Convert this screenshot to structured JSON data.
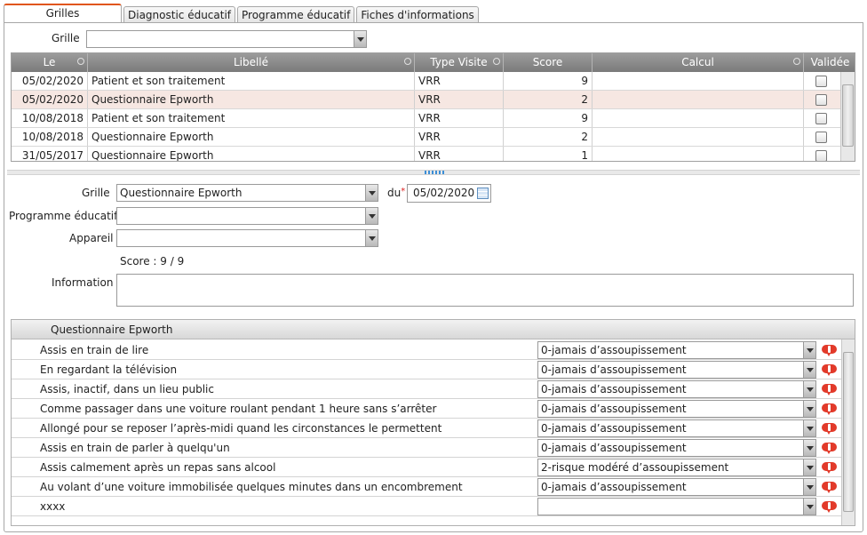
{
  "tabs": [
    "Grilles",
    "Diagnostic éducatif",
    "Programme éducatif",
    "Fiches d'informations"
  ],
  "filter": {
    "label": "Grille",
    "value": ""
  },
  "grid": {
    "columns": [
      "Le",
      "Libellé",
      "Type Visite",
      "Score",
      "Calcul",
      "Validée"
    ],
    "rows": [
      {
        "date": "05/02/2020",
        "libelle": "Patient et son traitement",
        "type": "VRR",
        "score": "9",
        "calcul": "",
        "validee": false
      },
      {
        "date": "05/02/2020",
        "libelle": "Questionnaire Epworth",
        "type": "VRR",
        "score": "2",
        "calcul": "",
        "validee": false
      },
      {
        "date": "10/08/2018",
        "libelle": "Patient et son traitement",
        "type": "VRR",
        "score": "9",
        "calcul": "",
        "validee": false
      },
      {
        "date": "10/08/2018",
        "libelle": "Questionnaire Epworth",
        "type": "VRR",
        "score": "2",
        "calcul": "",
        "validee": false
      },
      {
        "date": "31/05/2017",
        "libelle": "Questionnaire Epworth",
        "type": "VRR",
        "score": "1",
        "calcul": "",
        "validee": false
      }
    ]
  },
  "form": {
    "grille_label": "Grille",
    "grille_value": "Questionnaire Epworth",
    "du_label": "du",
    "date_value": "05/02/2020",
    "programme_label": "Programme éducatif",
    "programme_value": "",
    "appareil_label": "Appareil",
    "appareil_value": "",
    "score_text": "Score : 9 / 9",
    "information_label": "Information",
    "information_value": ""
  },
  "questionnaire": {
    "title": "Questionnaire Epworth",
    "items": [
      {
        "label": "Assis en train de lire",
        "value": "0-jamais d’assoupissement"
      },
      {
        "label": "En regardant la télévision",
        "value": "0-jamais d’assoupissement"
      },
      {
        "label": "Assis, inactif, dans un lieu public",
        "value": "0-jamais d’assoupissement"
      },
      {
        "label": "Comme passager dans une voiture roulant pendant 1 heure sans s’arrêter",
        "value": "0-jamais d’assoupissement"
      },
      {
        "label": "Allongé pour se reposer l’après-midi quand les circonstances le permettent",
        "value": "0-jamais d’assoupissement"
      },
      {
        "label": "Assis en train de parler à quelqu'un",
        "value": "0-jamais d’assoupissement"
      },
      {
        "label": "Assis calmement après un repas sans alcool",
        "value": "2-risque modéré d’assoupissement"
      },
      {
        "label": "Au volant d’une voiture immobilisée quelques minutes dans un encombrement",
        "value": "0-jamais d’assoupissement"
      },
      {
        "label": "xxxx",
        "value": ""
      }
    ]
  },
  "colors": {
    "accent": "#e0561d",
    "header": "#8a8a8a",
    "selected_row": "#f6e7e2",
    "alert": "#e23a2a"
  }
}
